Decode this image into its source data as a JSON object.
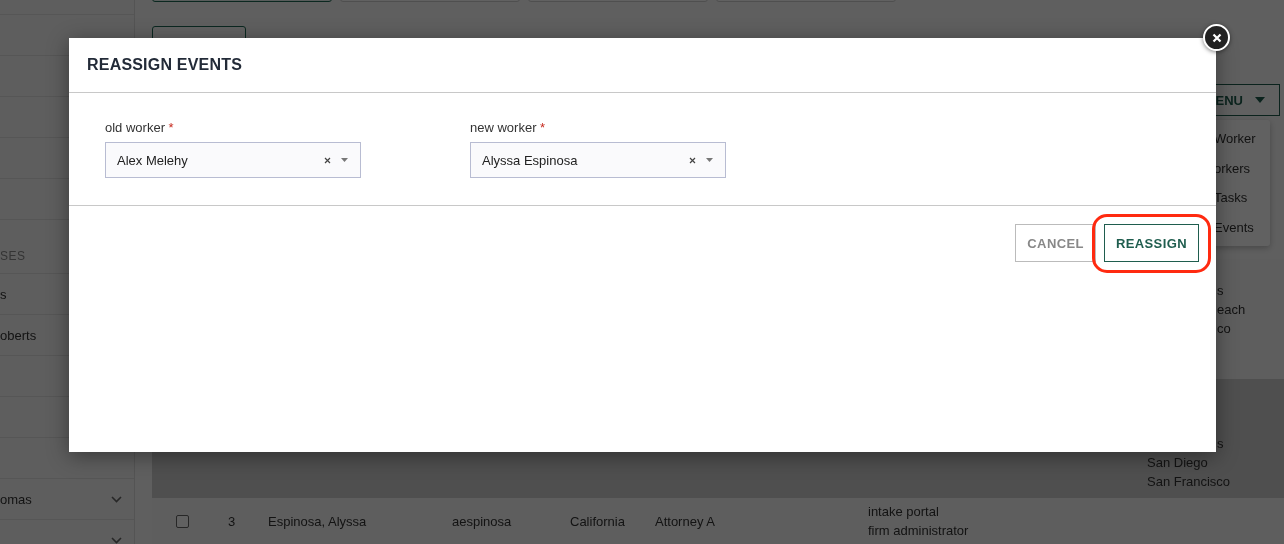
{
  "background": {
    "sidebar": {
      "section": {
        "label": "SES",
        "items": [
          {
            "kind": "label",
            "label": "s"
          },
          {
            "kind": "label",
            "label": "oberts"
          },
          {
            "kind": "blank"
          },
          {
            "kind": "blank"
          },
          {
            "kind": "blank"
          },
          {
            "kind": "label",
            "label": "omas",
            "expandable": true
          },
          {
            "kind": "blank",
            "expandable": true
          }
        ]
      }
    },
    "top_buttons": [
      {
        "selected": true
      },
      {
        "selected": false
      },
      {
        "selected": false
      },
      {
        "selected": false
      }
    ],
    "menu": {
      "label": "ENU",
      "expanded": true,
      "items": [
        "Worker",
        "orkers",
        "Tasks",
        "Events"
      ]
    },
    "table": {
      "rows": [
        {
          "shaded": false,
          "cities": [
            {
              "text": "s",
              "clipped": true
            },
            {
              "text": "each",
              "clipped": true
            },
            {
              "text": "co",
              "clipped": true
            }
          ]
        },
        {
          "shaded": true,
          "cities": [
            {
              "text": "s",
              "clipped": true
            },
            {
              "text": "San Diego",
              "clipped": false
            },
            {
              "text": "San Francisco",
              "clipped": false
            }
          ]
        },
        {
          "shaded": false,
          "checked": false,
          "number": "3",
          "name": "Espinosa, Alyssa",
          "username": "aespinosa",
          "state": "California",
          "title": "Attorney A",
          "roles": [
            "intake portal",
            "firm administrator"
          ]
        }
      ]
    }
  },
  "dialog": {
    "title": "REASSIGN EVENTS",
    "fields": [
      {
        "label": "old worker",
        "required_mark": "*",
        "value": "Alex Melehy"
      },
      {
        "label": "new worker",
        "required_mark": "*",
        "value": "Alyssa Espinosa"
      }
    ],
    "buttons": [
      {
        "label": "CANCEL",
        "kind": "secondary",
        "highlighted": false
      },
      {
        "label": "REASSIGN",
        "kind": "primary",
        "highlighted": true
      }
    ]
  }
}
